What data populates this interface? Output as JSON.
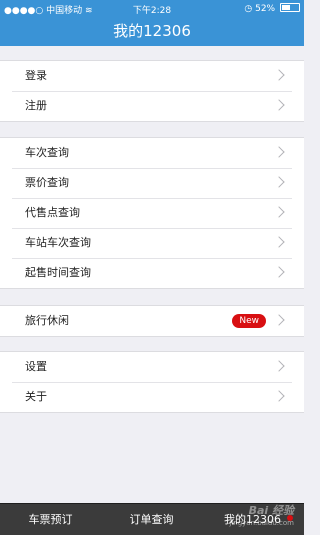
{
  "status_bar": {
    "carrier": "中国移动",
    "time": "下午2:28",
    "battery_level": 0.52,
    "battery_text": "52%"
  },
  "header": {
    "title": "我的12306"
  },
  "groups": [
    {
      "items": [
        {
          "label": "登录"
        },
        {
          "label": "注册"
        }
      ]
    },
    {
      "items": [
        {
          "label": "车次查询"
        },
        {
          "label": "票价查询"
        },
        {
          "label": "代售点查询"
        },
        {
          "label": "车站车次查询"
        },
        {
          "label": "起售时间查询"
        }
      ]
    },
    {
      "items": [
        {
          "label": "旅行休闲",
          "badge": "New"
        }
      ]
    },
    {
      "items": [
        {
          "label": "设置"
        },
        {
          "label": "关于"
        }
      ]
    }
  ],
  "tab_bar": {
    "tabs": [
      {
        "label": "车票预订"
      },
      {
        "label": "订单查询"
      },
      {
        "label": "我的12306",
        "active": true
      }
    ]
  },
  "watermark": {
    "text": "Bai 经验",
    "url": "jingyan.baidu.com"
  },
  "colors": {
    "header_bg": "#3a93d6",
    "badge_red": "#d80f12",
    "tab_bar_bg": "#3b3b3b"
  }
}
